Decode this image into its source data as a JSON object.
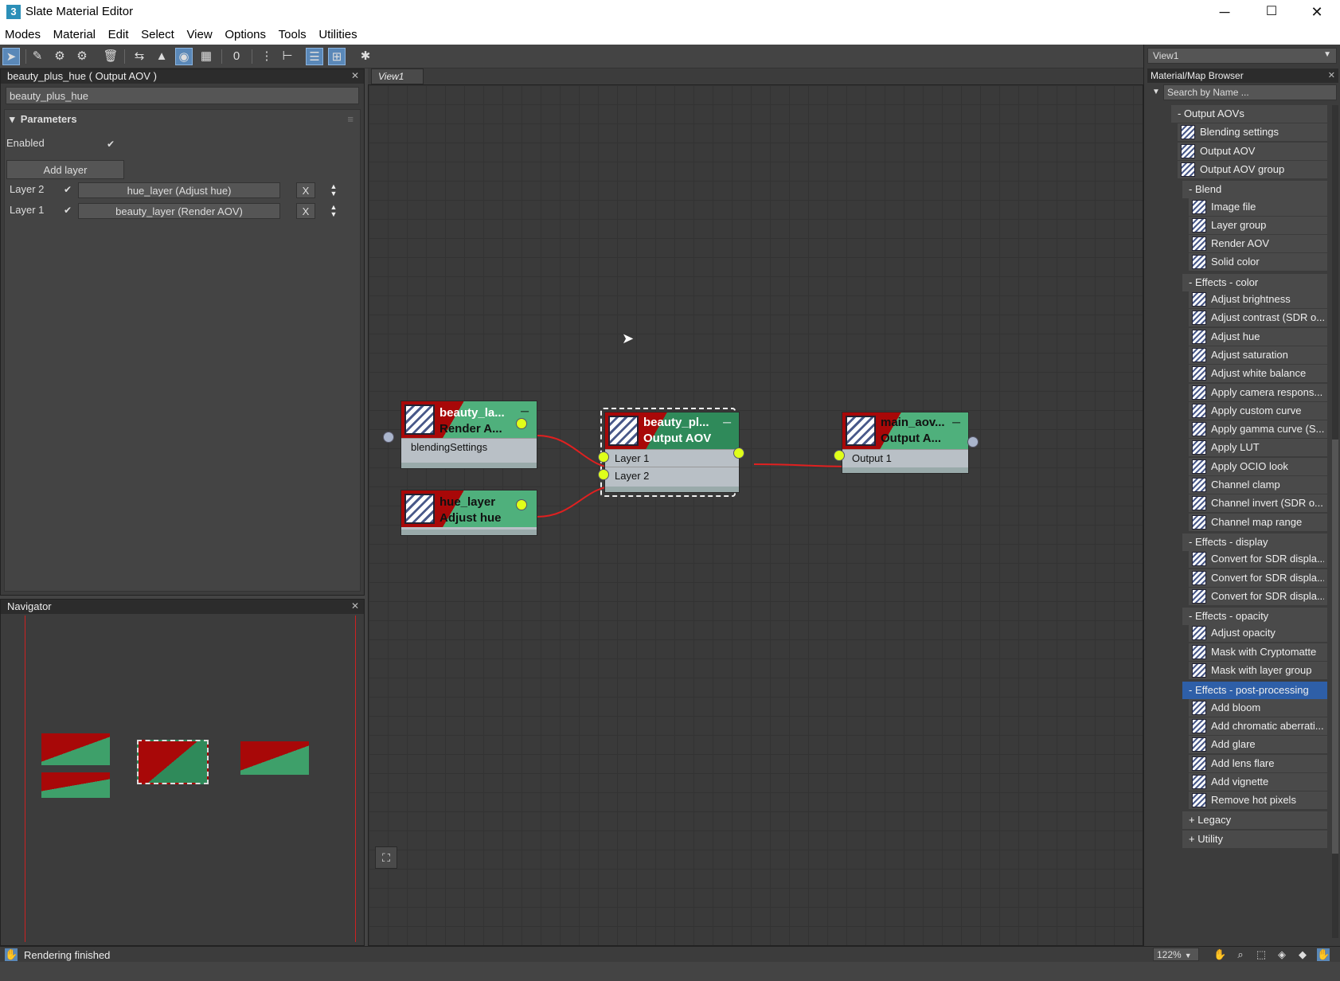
{
  "window": {
    "title": "Slate Material Editor",
    "app_icon": "3",
    "minimize": "─",
    "maximize": "☐",
    "close": "✕"
  },
  "menu": [
    "Modes",
    "Material",
    "Edit",
    "Select",
    "View",
    "Options",
    "Tools",
    "Utilities"
  ],
  "parameters_panel": {
    "title": "beauty_plus_hue  ( Output AOV )",
    "name_value": "beauty_plus_hue",
    "section": "Parameters",
    "enabled_label": "Enabled",
    "enabled_check": "✔",
    "add_layer": "Add layer",
    "layers": [
      {
        "label": "Layer 2",
        "check": "✔",
        "value": "hue_layer (Adjust hue)",
        "remove": "X"
      },
      {
        "label": "Layer 1",
        "check": "✔",
        "value": "beauty_layer (Render AOV)",
        "remove": "X"
      }
    ]
  },
  "navigator": {
    "title": "Navigator"
  },
  "view": {
    "tab": "View1",
    "nodes": {
      "beauty_layer": {
        "name": "beauty_la...",
        "type": "Render A...",
        "slot": "blendingSettings"
      },
      "hue_layer": {
        "name": "hue_layer",
        "type": "Adjust hue"
      },
      "beauty_plus_hue": {
        "name": "beauty_pl...",
        "type": "Output AOV",
        "slot1": "Layer 1",
        "slot2": "Layer 2"
      },
      "main_aov": {
        "name": "main_aov...",
        "type": "Output A...",
        "slot": "Output 1"
      }
    }
  },
  "browser": {
    "view_select": "View1",
    "title": "Material/Map Browser",
    "search_placeholder": "Search by Name ...",
    "tree": [
      {
        "kind": "group",
        "label": "- Output AOVs",
        "indent": 0
      },
      {
        "kind": "item",
        "label": "Blending settings",
        "indent": 0
      },
      {
        "kind": "item",
        "label": "Output AOV",
        "indent": 0
      },
      {
        "kind": "item",
        "label": "Output AOV group",
        "indent": 0
      },
      {
        "kind": "group",
        "label": "- Blend",
        "indent": 1
      },
      {
        "kind": "item",
        "label": "Image file",
        "indent": 1
      },
      {
        "kind": "item",
        "label": "Layer group",
        "indent": 1
      },
      {
        "kind": "item",
        "label": "Render AOV",
        "indent": 1
      },
      {
        "kind": "item",
        "label": "Solid color",
        "indent": 1
      },
      {
        "kind": "group",
        "label": "- Effects - color",
        "indent": 1
      },
      {
        "kind": "item",
        "label": "Adjust brightness",
        "indent": 1
      },
      {
        "kind": "item",
        "label": "Adjust contrast (SDR o...",
        "indent": 1
      },
      {
        "kind": "item",
        "label": "Adjust hue",
        "indent": 1
      },
      {
        "kind": "item",
        "label": "Adjust saturation",
        "indent": 1
      },
      {
        "kind": "item",
        "label": "Adjust white balance",
        "indent": 1
      },
      {
        "kind": "item",
        "label": "Apply camera respons...",
        "indent": 1
      },
      {
        "kind": "item",
        "label": "Apply custom curve",
        "indent": 1
      },
      {
        "kind": "item",
        "label": "Apply gamma curve (S...",
        "indent": 1
      },
      {
        "kind": "item",
        "label": "Apply LUT",
        "indent": 1
      },
      {
        "kind": "item",
        "label": "Apply OCIO look",
        "indent": 1
      },
      {
        "kind": "item",
        "label": "Channel clamp",
        "indent": 1
      },
      {
        "kind": "item",
        "label": "Channel invert (SDR o...",
        "indent": 1
      },
      {
        "kind": "item",
        "label": "Channel map range",
        "indent": 1
      },
      {
        "kind": "group",
        "label": "- Effects - display",
        "indent": 1
      },
      {
        "kind": "item",
        "label": "Convert for SDR displa...",
        "indent": 1
      },
      {
        "kind": "item",
        "label": "Convert for SDR displa...",
        "indent": 1
      },
      {
        "kind": "item",
        "label": "Convert for SDR displa...",
        "indent": 1
      },
      {
        "kind": "group",
        "label": "- Effects - opacity",
        "indent": 1
      },
      {
        "kind": "item",
        "label": "Adjust opacity",
        "indent": 1
      },
      {
        "kind": "item",
        "label": "Mask with Cryptomatte",
        "indent": 1
      },
      {
        "kind": "item",
        "label": "Mask with layer group",
        "indent": 1
      },
      {
        "kind": "group",
        "label": "- Effects - post-processing",
        "indent": 1,
        "selected": true
      },
      {
        "kind": "item",
        "label": "Add bloom",
        "indent": 1
      },
      {
        "kind": "item",
        "label": "Add chromatic aberrati...",
        "indent": 1
      },
      {
        "kind": "item",
        "label": "Add glare",
        "indent": 1
      },
      {
        "kind": "item",
        "label": "Add lens flare",
        "indent": 1
      },
      {
        "kind": "item",
        "label": "Add vignette",
        "indent": 1
      },
      {
        "kind": "item",
        "label": "Remove hot pixels",
        "indent": 1
      },
      {
        "kind": "group",
        "label": "+ Legacy",
        "indent": 1
      },
      {
        "kind": "group",
        "label": "+ Utility",
        "indent": 1
      }
    ]
  },
  "status": {
    "text": "Rendering finished",
    "zoom": "122%"
  },
  "colors": {
    "accent": "#2e5fa8",
    "node_red": "#a80808",
    "node_green": "#4fb07c",
    "socket": "#dfff1a",
    "wire": "#e02020"
  }
}
